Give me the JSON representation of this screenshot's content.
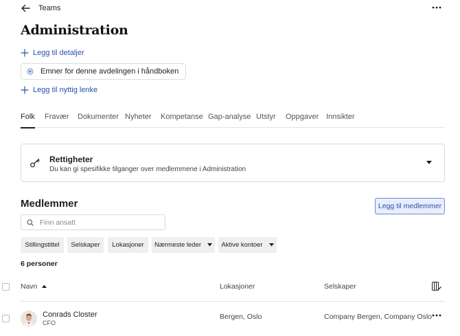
{
  "header": {
    "breadcrumb": "Teams",
    "back_icon": "arrow-left-icon",
    "more_icon": "more-horizontal-icon"
  },
  "page": {
    "title": "Administration"
  },
  "links": {
    "add_details": "Legg til detaljer",
    "add_useful_link": "Legg til nyttig lenke"
  },
  "handbook_chip": {
    "label": "Emner for denne avdelingen i håndboken",
    "icon": "handbook-icon"
  },
  "tabs": [
    {
      "label": "Folk",
      "active": true
    },
    {
      "label": "Fravær"
    },
    {
      "label": "Dokumenter"
    },
    {
      "label": "Nyheter"
    },
    {
      "label": "Kompetanse"
    },
    {
      "label": "Gap-analyse"
    },
    {
      "label": "Utstyr"
    },
    {
      "label": "Oppgaver"
    },
    {
      "label": "Innsikter"
    }
  ],
  "rights": {
    "title": "Rettigheter",
    "description": "Du kan gi spesifikke tilganger over medlemmene i Administration",
    "icon": "key-icon"
  },
  "members": {
    "title": "Medlemmer",
    "add_button": "Legg til medlemmer",
    "search_placeholder": "Finn ansatt",
    "filters": [
      "Stillingstittel",
      "Selskaper",
      "Lokasjoner",
      "Nærmeste leder",
      "Aktive kontoer"
    ],
    "count_label": "6 personer",
    "columns": {
      "name": "Navn",
      "locations": "Lokasjoner",
      "companies": "Selskaper"
    },
    "rows": [
      {
        "name": "Conrads Closter",
        "title": "CFO",
        "location": "Bergen, Oslo",
        "companies": "Company Bergen, Company Oslo"
      }
    ]
  },
  "colors": {
    "link_blue": "#2b4fa8",
    "button_bg": "#e8eefc",
    "button_border": "#6f8ad6"
  }
}
